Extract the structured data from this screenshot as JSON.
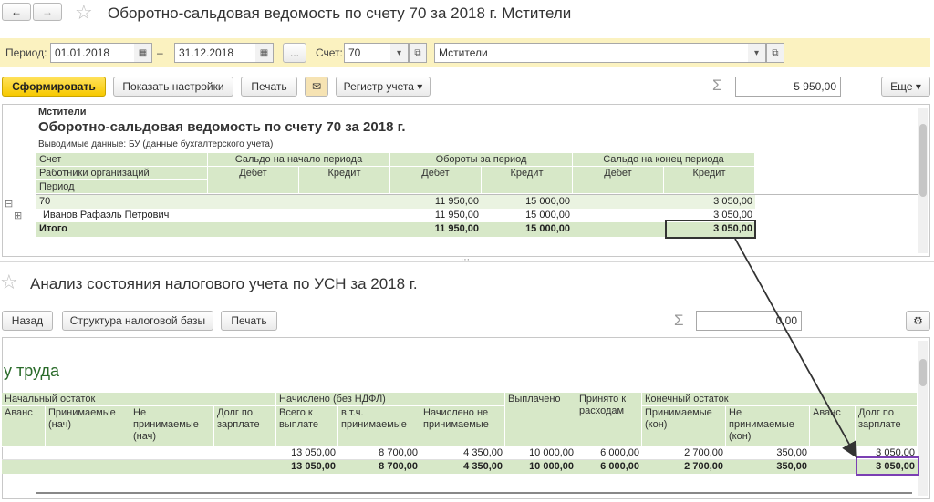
{
  "top_window": {
    "title": "Оборотно-сальдовая ведомость по счету 70 за 2018 г. Мстители",
    "period_label": "Период:",
    "period_from": "01.01.2018",
    "period_dash": "–",
    "period_to": "31.12.2018",
    "period_more": "...",
    "account_label": "Счет:",
    "account_value": "70",
    "org_value": "Мстители",
    "toolbar": {
      "generate": "Сформировать",
      "settings": "Показать настройки",
      "print": "Печать",
      "register": "Регистр учета",
      "sum_value": "5 950,00",
      "more": "Еще"
    },
    "report": {
      "org": "Мстители",
      "title": "Оборотно-сальдовая ведомость по счету 70 за 2018 г.",
      "subtitle": "Выводимые данные:  БУ (данные бухгалтерского учета)",
      "headers": {
        "account": "Счет",
        "employees": "Работники организаций",
        "period": "Период",
        "open_balance": "Сальдо на начало периода",
        "turnover": "Обороты за период",
        "close_balance": "Сальдо на конец периода",
        "debit": "Дебет",
        "credit": "Кредит"
      },
      "rows": [
        {
          "name": "70",
          "turn_debit": "11 950,00",
          "turn_credit": "15 000,00",
          "close_credit": "3 050,00"
        },
        {
          "name": "Иванов Рафаэль Петрович",
          "turn_debit": "11 950,00",
          "turn_credit": "15 000,00",
          "close_credit": "3 050,00"
        }
      ],
      "total": {
        "name": "Итого",
        "turn_debit": "11 950,00",
        "turn_credit": "15 000,00",
        "close_credit": "3 050,00"
      }
    }
  },
  "bottom_window": {
    "title": "Анализ состояния налогового учета по УСН за 2018 г.",
    "toolbar": {
      "back": "Назад",
      "structure": "Структура налоговой базы",
      "print": "Печать",
      "sum_value": "0,00"
    },
    "report": {
      "heading": "у труда",
      "group_headers": {
        "start": "Начальный остаток",
        "accrued": "Начислено (без НДФЛ)",
        "paid": "Выплачено",
        "accepted": "Принято к расходам",
        "end": "Конечный остаток"
      },
      "col_headers": [
        "Аванс",
        "Принимаемые (нач)",
        "Не принимаемые (нач)",
        "Долг по зарплате",
        "Всего к выплате",
        "в т.ч. принимаемые",
        "Начислено не принимаемые",
        "",
        "",
        "Принимаемые (кон)",
        "Не принимаемые (кон)",
        "Аванс",
        "Долг по зарплате"
      ],
      "row": [
        "",
        "",
        "",
        "",
        "13 050,00",
        "8 700,00",
        "4 350,00",
        "10 000,00",
        "6 000,00",
        "2 700,00",
        "350,00",
        "",
        "3 050,00"
      ],
      "total": [
        "",
        "",
        "",
        "",
        "13 050,00",
        "8 700,00",
        "4 350,00",
        "10 000,00",
        "6 000,00",
        "2 700,00",
        "350,00",
        "",
        "3 050,00"
      ]
    }
  },
  "colors": {
    "accent": "#f7c900",
    "table_header": "#d7e8c8",
    "highlight_top": "#333333",
    "highlight_bottom": "#7b3fb3"
  }
}
